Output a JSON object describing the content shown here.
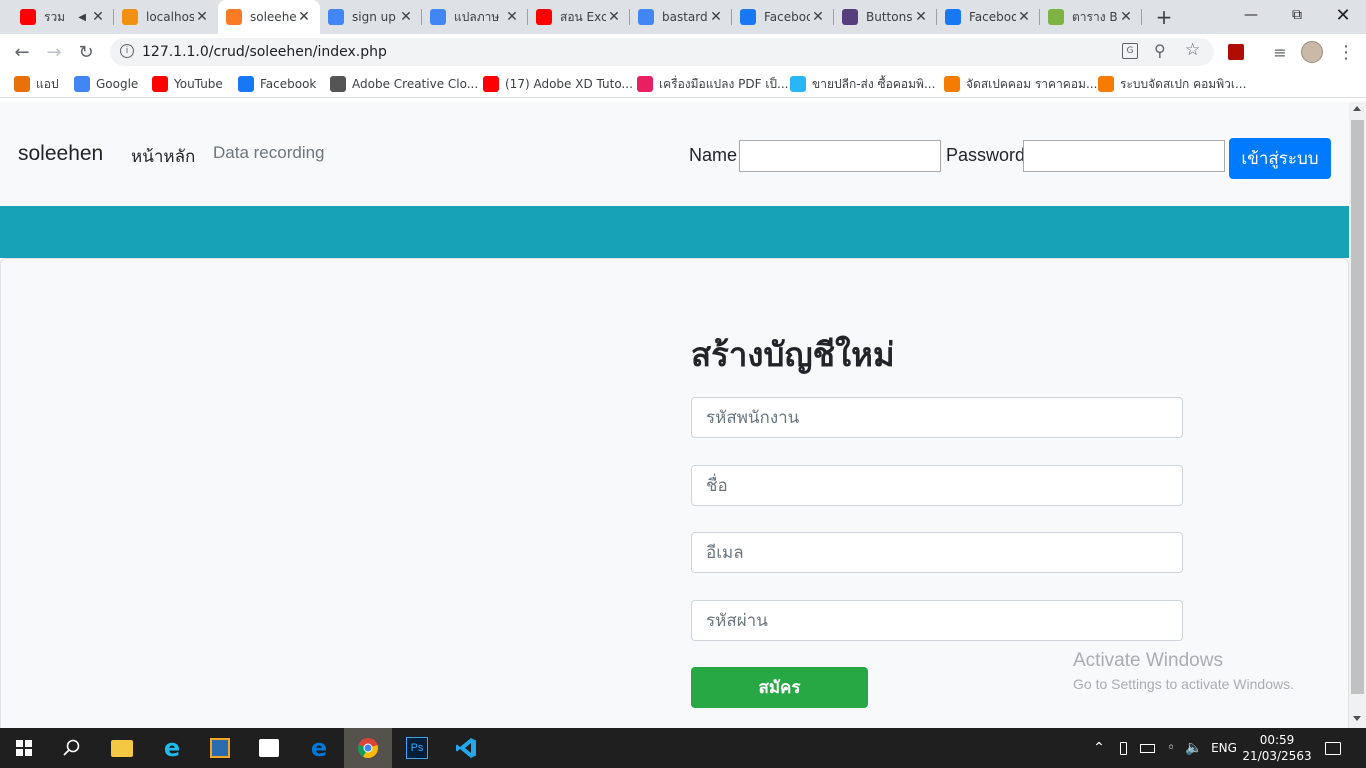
{
  "tabs": [
    {
      "title": "รวม",
      "favicon": "youtube-icon",
      "color": "#ff0000",
      "audio": true
    },
    {
      "title": "localhost",
      "favicon": "phpmyadmin-icon",
      "color": "#f29111"
    },
    {
      "title": "soleehen",
      "favicon": "xampp-icon",
      "color": "#fb7a24",
      "active": true
    },
    {
      "title": "sign up",
      "favicon": "google-icon",
      "color": "#4285f4"
    },
    {
      "title": "แปลภาษ",
      "favicon": "google-icon",
      "color": "#4285f4"
    },
    {
      "title": "สอน Exc",
      "favicon": "youtube-icon",
      "color": "#ff0000"
    },
    {
      "title": "bastard",
      "favicon": "google-icon",
      "color": "#4285f4"
    },
    {
      "title": "Facebook",
      "favicon": "facebook-icon",
      "color": "#1877f2"
    },
    {
      "title": "Buttons",
      "favicon": "bootstrap-icon",
      "color": "#563d7c"
    },
    {
      "title": "Facebook",
      "favicon": "facebook-icon",
      "color": "#1877f2"
    },
    {
      "title": "ตาราง B",
      "favicon": "webpage-icon",
      "color": "#7cb342"
    }
  ],
  "address_bar": {
    "url": "127.1.1.0/crud/soleehen/index.php"
  },
  "bookmarks": [
    {
      "label": "แอป",
      "icon": "apps-grid-icon",
      "color": "#e8710a"
    },
    {
      "label": "Google",
      "icon": "google-icon",
      "color": "#4285f4"
    },
    {
      "label": "YouTube",
      "icon": "youtube-icon",
      "color": "#ff0000"
    },
    {
      "label": "Facebook",
      "icon": "facebook-icon",
      "color": "#1877f2"
    },
    {
      "label": "Adobe Creative Clo...",
      "icon": "creative-cloud-icon",
      "color": "#555555"
    },
    {
      "label": "(17) Adobe XD Tuto...",
      "icon": "youtube-icon",
      "color": "#ff0000"
    },
    {
      "label": "เครื่องมือแปลง PDF เป็...",
      "icon": "pdf-tool-icon",
      "color": "#e91e63"
    },
    {
      "label": "ขายปลีก-ส่ง ซื้อคอมพิ...",
      "icon": "advice-icon",
      "color": "#29b6f6"
    },
    {
      "label": "จัดสเปคคอม ราคาคอม...",
      "icon": "nb-icon",
      "color": "#f57c00"
    },
    {
      "label": "ระบบจัดสเปก คอมพิวเ...",
      "icon": "nb-icon",
      "color": "#f57c00"
    }
  ],
  "navbar": {
    "brand": "soleehen",
    "links": [
      "หน้าหลัก",
      "Data recording"
    ],
    "name_label": "Name",
    "password_label": "Password",
    "login_button": "เข้าสู่ระบบ"
  },
  "form": {
    "title": "สร้างบัญชีใหม่",
    "employee_id_placeholder": "รหัสพนักงาน",
    "name_placeholder": "ชื่อ",
    "email_placeholder": "อีเมล",
    "password_placeholder": "รหัสผ่าน",
    "submit_label": "สมัคร"
  },
  "watermark": {
    "line1": "Activate Windows",
    "line2": "Go to Settings to activate Windows."
  },
  "taskbar": {
    "language": "ENG",
    "time": "00:59",
    "date": "21/03/2563"
  },
  "colors": {
    "primary": "#007bff",
    "success": "#28a745",
    "info": "#17a2b8",
    "navbar_bg": "#f8f9fa"
  }
}
